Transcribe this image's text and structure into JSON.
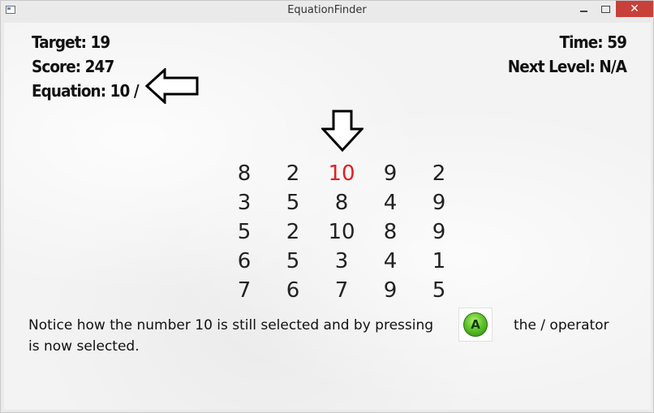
{
  "window": {
    "title": "EquationFinder",
    "close_glyph": "✕"
  },
  "hud": {
    "target": "Target: 19",
    "score": "Score: 247",
    "equation": "Equation: 10 /",
    "time": "Time:  59",
    "next_level": "Next Level: N/A"
  },
  "grid": {
    "rows": [
      [
        "8",
        "2",
        "10",
        "9",
        "2"
      ],
      [
        "3",
        "5",
        "8",
        "4",
        "9"
      ],
      [
        "5",
        "2",
        "10",
        "8",
        "9"
      ],
      [
        "6",
        "5",
        "3",
        "4",
        "1"
      ],
      [
        "7",
        "6",
        "7",
        "9",
        "5"
      ]
    ],
    "selected": {
      "row": 0,
      "col": 2
    },
    "selected_color": "#e02020"
  },
  "instructions": {
    "part1": "Notice how the number 10 is still selected and by pressing",
    "button_label": "A",
    "part2": "the / operator",
    "line2": "is now selected."
  },
  "colors": {
    "a_button": "#5fc42a"
  }
}
